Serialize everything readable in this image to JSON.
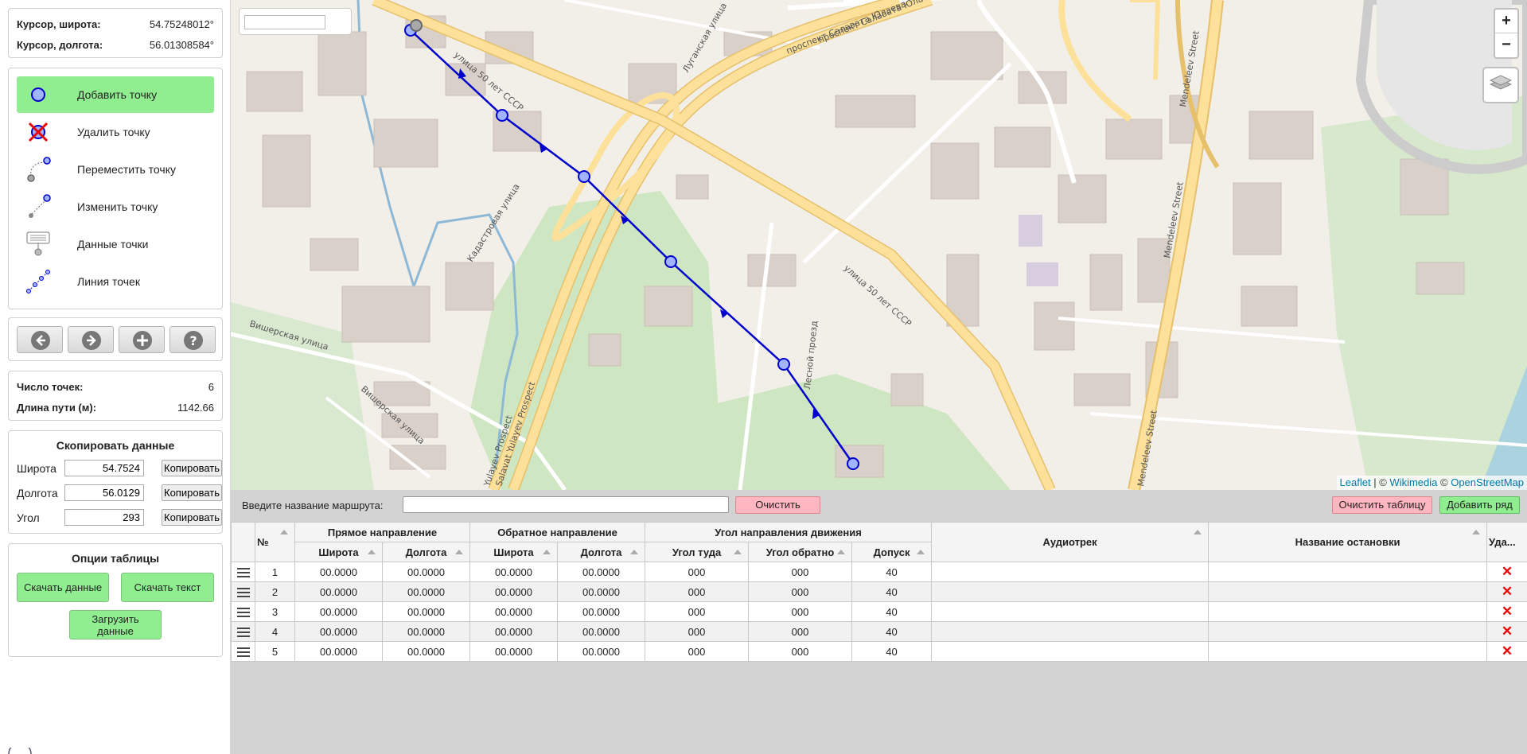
{
  "cursor": {
    "lat_label": "Курсор, широта:",
    "lat_value": "54.75248012°",
    "lon_label": "Курсор, долгота:",
    "lon_value": "56.01308584°"
  },
  "tools": [
    {
      "label": "Добавить точку",
      "icon": "add-point-icon",
      "active": true
    },
    {
      "label": "Удалить точку",
      "icon": "delete-point-icon",
      "active": false
    },
    {
      "label": "Переместить точку",
      "icon": "move-point-icon",
      "active": false
    },
    {
      "label": "Изменить точку",
      "icon": "edit-point-icon",
      "active": false
    },
    {
      "label": "Данные точки",
      "icon": "point-data-icon",
      "active": false
    },
    {
      "label": "Линия точек",
      "icon": "points-line-icon",
      "active": false
    }
  ],
  "nav_buttons": [
    "arrow-left-icon",
    "arrow-right-icon",
    "plus-icon",
    "help-icon"
  ],
  "stats": {
    "count_label": "Число точек:",
    "count_value": "6",
    "length_label": "Длина пути (м):",
    "length_value": "1142.66"
  },
  "copy": {
    "title": "Скопировать данные",
    "rows": [
      {
        "label": "Широта",
        "value": "54.7524",
        "button": "Копировать"
      },
      {
        "label": "Долгота",
        "value": "56.0129",
        "button": "Копировать"
      },
      {
        "label": "Угол",
        "value": "293",
        "button": "Копировать"
      }
    ]
  },
  "table_options": {
    "title": "Опции таблицы",
    "download_data": "Скачать данные",
    "download_text": "Скачать текст",
    "load_data": "Загрузить данные"
  },
  "map": {
    "zoom_in": "+",
    "zoom_out": "−",
    "streets": [
      "улица 50 лет СССР",
      "улица 50 лет СССР",
      "проспект Салавата Юлаева",
      "проспект Салавата Юлаева",
      "Луганская улица",
      "Кадастровая улица",
      "Вишерская улица",
      "Вишерская улица",
      "Лесной проезд",
      "Mendeleev Street",
      "Mendeleev Street",
      "Mendeleev Street",
      "Salavat Yulayev Prospect",
      "Yulayev Prospect"
    ],
    "attribution": {
      "leaflet": "Leaflet",
      "sep1": "| ©",
      "wikimedia": "Wikimedia",
      "sep2": "©",
      "osm": "OpenStreetMap"
    },
    "route_color": "#0000cc",
    "point_color": "#a0b4ff"
  },
  "route_form": {
    "label": "Введите название маршрута:",
    "value": "",
    "clear_button": "Очистить",
    "clear_table_button": "Очистить таблицу",
    "add_row_button": "Добавить ряд"
  },
  "table": {
    "groups": {
      "direct": "Прямое направление",
      "reverse": "Обратное направление",
      "angle": "Угол направления движения"
    },
    "columns": [
      "№",
      "Широта",
      "Долгота",
      "Широта",
      "Долгота",
      "Угол туда",
      "Угол обратно",
      "Допуск",
      "Аудиотрек",
      "Название остановки",
      "Уда..."
    ],
    "rows": [
      {
        "n": "1",
        "lat1": "00.0000",
        "lon1": "00.0000",
        "lat2": "00.0000",
        "lon2": "00.0000",
        "a1": "000",
        "a2": "000",
        "tol": "40",
        "audio": "",
        "stop": ""
      },
      {
        "n": "2",
        "lat1": "00.0000",
        "lon1": "00.0000",
        "lat2": "00.0000",
        "lon2": "00.0000",
        "a1": "000",
        "a2": "000",
        "tol": "40",
        "audio": "",
        "stop": ""
      },
      {
        "n": "3",
        "lat1": "00.0000",
        "lon1": "00.0000",
        "lat2": "00.0000",
        "lon2": "00.0000",
        "a1": "000",
        "a2": "000",
        "tol": "40",
        "audio": "",
        "stop": ""
      },
      {
        "n": "4",
        "lat1": "00.0000",
        "lon1": "00.0000",
        "lat2": "00.0000",
        "lon2": "00.0000",
        "a1": "000",
        "a2": "000",
        "tol": "40",
        "audio": "",
        "stop": ""
      },
      {
        "n": "5",
        "lat1": "00.0000",
        "lon1": "00.0000",
        "lat2": "00.0000",
        "lon2": "00.0000",
        "a1": "000",
        "a2": "000",
        "tol": "40",
        "audio": "",
        "stop": ""
      }
    ],
    "delete_symbol": "✕"
  }
}
